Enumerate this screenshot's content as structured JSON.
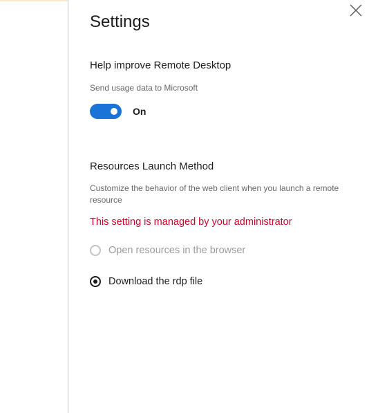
{
  "settings": {
    "title": "Settings",
    "help_section": {
      "title": "Help improve Remote Desktop",
      "description": "Send usage data to Microsoft",
      "toggle_state": "On",
      "toggle_on": true
    },
    "launch_section": {
      "title": "Resources Launch Method",
      "description": "Customize the behavior of the web client when you launch a remote resource",
      "managed_notice": "This setting is managed by your administrator",
      "options": [
        {
          "label": "Open resources in the browser",
          "selected": false,
          "disabled": true
        },
        {
          "label": "Download the rdp file",
          "selected": true,
          "disabled": false
        }
      ]
    }
  },
  "colors": {
    "accent": "#1a73d6",
    "managed_text": "#d4002a"
  },
  "icons": {
    "close": "close-icon"
  }
}
